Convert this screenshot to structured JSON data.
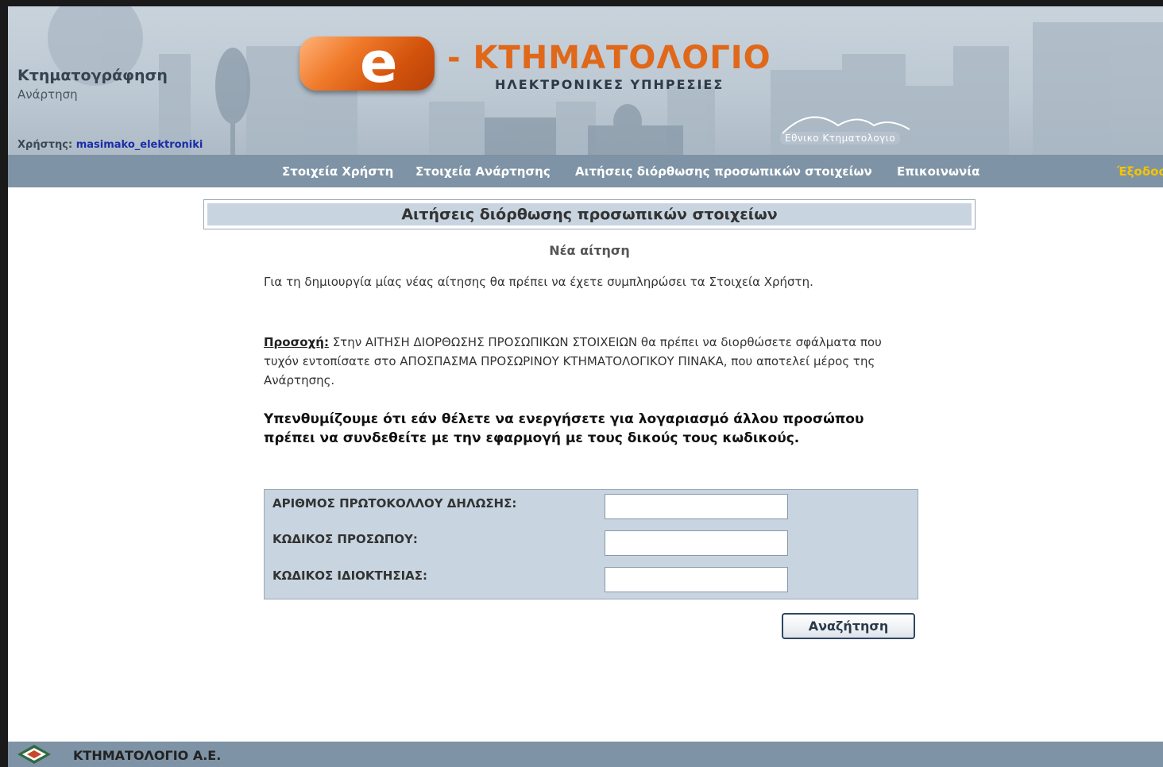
{
  "header": {
    "section_title": "Κτηματογράφηση",
    "section_subtitle": "Ανάρτηση",
    "user_label": "Χρήστης:",
    "username": "masimako_elektroniki",
    "logo_letter": "e",
    "logo_title": "- ΚΤΗΜΑΤΟΛΟΓΙΟ",
    "logo_subtitle": "ΗΛΕΚΤΡΟΝΙΚΕΣ ΥΠΗΡΕΣΙΕΣ",
    "national_logo_text": "Εθνικο Κτηματολογιο"
  },
  "nav": {
    "items": [
      "Στοιχεία Χρήστη",
      "Στοιχεία Ανάρτησης",
      "Αιτήσεις διόρθωσης προσωπικών στοιχείων",
      "Επικοινωνία"
    ],
    "exit_label": "Έξοδος"
  },
  "main": {
    "heading": "Αιτήσεις διόρθωσης προσωπικών στοιχείων",
    "subheading": "Νέα αίτηση",
    "intro": "Για τη δημιουργία μίας νέας αίτησης θα πρέπει να έχετε συμπληρώσει τα Στοιχεία Χρήστη.",
    "warning_label": "Προσοχή:",
    "warning_text": " Στην ΑΙΤΗΣΗ ΔΙΟΡΘΩΣΗΣ ΠΡΟΣΩΠΙΚΩΝ ΣΤΟΙΧΕΙΩΝ θα πρέπει να διορθώσετε σφάλματα που τυχόν εντοπίσατε στο ΑΠΟΣΠΑΣΜΑ ΠΡΟΣΩΡΙΝΟΥ ΚΤΗΜΑΤΟΛΟΓΙΚΟΥ ΠΙΝΑΚΑ, που αποτελεί μέρος της Ανάρτησης.",
    "reminder": "Υπενθυμίζουμε ότι εάν θέλετε να ενεργήσετε για λογαριασμό άλλου προσώπου πρέπει να συνδεθείτε με την εφαρμογή με τους δικούς τους κωδικούς."
  },
  "form": {
    "fields": [
      {
        "label": "ΑΡΙΘΜΟΣ ΠΡΩΤΟΚΟΛΛΟΥ ΔΗΛΩΣΗΣ:",
        "value": ""
      },
      {
        "label": "ΚΩΔΙΚΟΣ ΠΡΟΣΩΠΟΥ:",
        "value": ""
      },
      {
        "label": "ΚΩΔΙΚΟΣ ΙΔΙΟΚΤΗΣΙΑΣ:",
        "value": ""
      }
    ],
    "search_label": "Αναζήτηση"
  },
  "footer": {
    "company": "ΚΤΗΜΑΤΟΛΟΓΙΟ Α.Ε."
  },
  "colors": {
    "nav_bg": "#7e93a5",
    "panel_bg": "#c8d5e0",
    "logo_orange": "#e0681a",
    "exit_yellow": "#f5c400",
    "username_blue": "#1a2ea8"
  }
}
